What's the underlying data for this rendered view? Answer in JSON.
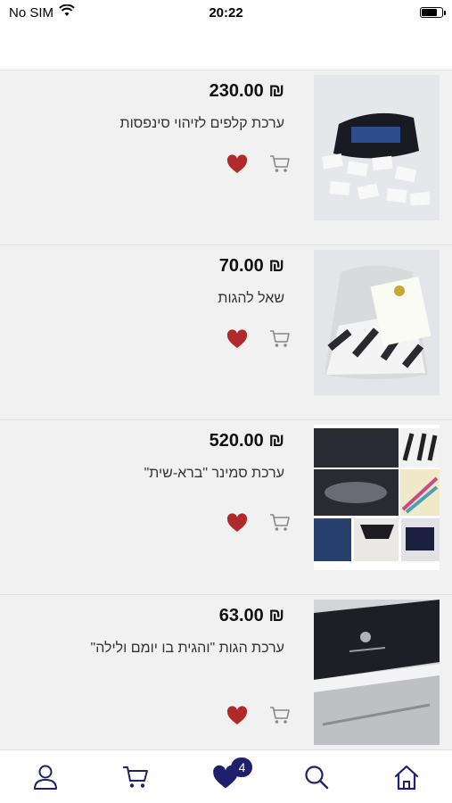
{
  "status": {
    "carrier": "No SIM",
    "time": "20:22",
    "battery_level": 0.8
  },
  "products": [
    {
      "price": "₪ 230.00",
      "title": "ערכת קלפים לזיהוי סינפסות"
    },
    {
      "price": "₪ 70.00",
      "title": "שאל להגות"
    },
    {
      "price": "₪ 520.00",
      "title": "ערכת סמינר \"ברא-שית\""
    },
    {
      "price": "₪ 63.00",
      "title": "ערכת הגות \"והגית בו יומם ולילה\""
    }
  ],
  "colors": {
    "accent": "#1f1f6e",
    "heart": "#b02a2a",
    "list_bg": "#f1f1f2"
  },
  "tabbar": {
    "favorites_count": "4"
  }
}
